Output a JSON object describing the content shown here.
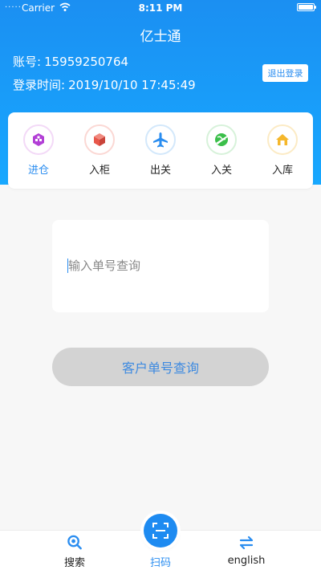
{
  "status_bar": {
    "signal": "·····",
    "carrier": "Carrier",
    "time": "8:11 PM"
  },
  "header": {
    "title": "亿士通",
    "account_label": "账号:",
    "account_value": "15959250764",
    "login_time_label": "登录时间:",
    "login_time_value": "2019/10/10 17:45:49",
    "logout_label": "退出登录"
  },
  "quick_actions": [
    {
      "label": "进仓",
      "icon": "warehouse-in-icon",
      "color": "#b23fd6",
      "ring": "#f3d9f7"
    },
    {
      "label": "入柜",
      "icon": "box-icon",
      "color": "#e8574a",
      "ring": "#fbd8d4"
    },
    {
      "label": "出关",
      "icon": "airplane-icon",
      "color": "#2a8df0",
      "ring": "#d3e8fb"
    },
    {
      "label": "入关",
      "icon": "globe-plane-icon",
      "color": "#3bbf4a",
      "ring": "#d7f2da"
    },
    {
      "label": "入库",
      "icon": "house-icon",
      "color": "#f5b72b",
      "ring": "#fcebc5"
    }
  ],
  "search": {
    "placeholder": "输入单号查询",
    "value": ""
  },
  "query_button_label": "客户单号查询",
  "tabs": [
    {
      "label": "搜索",
      "icon": "search-icon"
    },
    {
      "label": "扫码",
      "icon": "scan-icon"
    },
    {
      "label": "english",
      "icon": "swap-icon"
    }
  ],
  "colors": {
    "accent": "#2a8df0",
    "header_top": "#1b8ff2",
    "header_bottom": "#17a8ff"
  }
}
